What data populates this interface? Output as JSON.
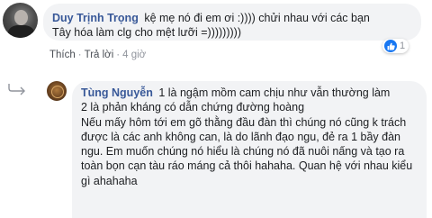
{
  "top_comment": {
    "author": "Duy Trịnh Trọng",
    "text": "kệ mẹ nó đi em ơi :)))) chửi nhau với các bạn Tây hóa làm clg cho mệt lưỡi =)))))))))",
    "reaction_count": "1",
    "actions": {
      "like": "Thích",
      "reply": "Trả lời",
      "time": "4 giờ"
    }
  },
  "reply_comment": {
    "author": "Tùng Nguyễn",
    "paragraphs": [
      "1 là ngậm mồm cam chịu như vẫn thường làm",
      "2 là phản kháng có dẫn chứng đường hoàng",
      "Nếu mấy hôm tới em gõ thằng đầu đàn thì chúng nó cũng k trách được là các anh không can, là do lãnh đạo ngu, đẻ ra 1 bầy đàn ngu. Em muốn chúng nó hiểu là chúng nó đã nuôi nấng và tạo ra toàn bọn cạn tàu ráo máng cả thôi hahaha. Quan hệ với nhau kiểu gì ahahaha"
    ]
  },
  "colors": {
    "bubble": "#f2f3f5",
    "author": "#385898",
    "meta": "#90949c",
    "like_blue": "#1877f2"
  }
}
